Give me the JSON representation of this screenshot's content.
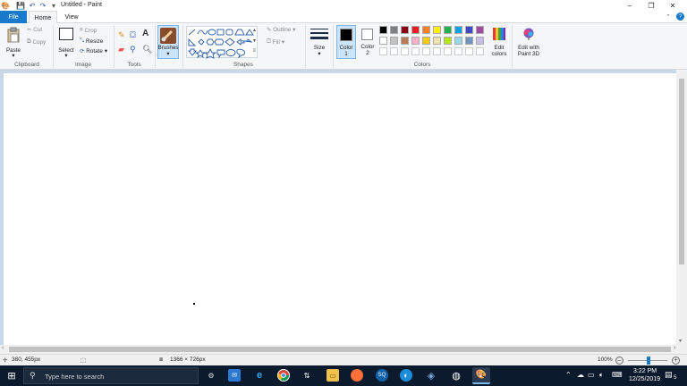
{
  "window": {
    "title": "Untitled - Paint",
    "controls": {
      "minimize": "–",
      "maximize": "❐",
      "close": "✕"
    }
  },
  "ribbon_tabs": [
    {
      "label": "File"
    },
    {
      "label": "Home"
    },
    {
      "label": "View"
    }
  ],
  "ribbon": {
    "clipboard": {
      "group_label": "Clipboard",
      "paste": "Paste",
      "cut": "Cut",
      "copy": "Copy"
    },
    "image": {
      "group_label": "Image",
      "select": "Select",
      "crop": "Crop",
      "resize": "Resize",
      "rotate": "Rotate"
    },
    "tools": {
      "group_label": "Tools"
    },
    "brushes": {
      "label": "Brushes"
    },
    "shapes": {
      "group_label": "Shapes",
      "outline": "Outline",
      "fill": "Fill"
    },
    "size": {
      "label": "Size"
    },
    "colors": {
      "group_label": "Colors",
      "color1_label": "Color",
      "color1_num": "1",
      "color2_label": "Color",
      "color2_num": "2",
      "color1": "#000000",
      "color2": "#ffffff",
      "edit_colors": "Edit colors",
      "paint3d": "Edit with Paint 3D",
      "palette_row1": [
        "#000000",
        "#7f7f7f",
        "#880015",
        "#ed1c24",
        "#ff7f27",
        "#fff200",
        "#22b14c",
        "#00a2e8",
        "#3f48cc",
        "#a349a4"
      ],
      "palette_row2": [
        "#ffffff",
        "#c3c3c3",
        "#b97a57",
        "#ffaec9",
        "#ffc90e",
        "#efe4b0",
        "#b5e61d",
        "#99d9ea",
        "#7092be",
        "#c8bfe7"
      ]
    }
  },
  "status": {
    "cursor": "380, 455px",
    "image_size": "1366 × 726px",
    "zoom": "100%"
  },
  "taskbar": {
    "search_placeholder": "Type here to search",
    "time": "3:22 PM",
    "date": "12/25/2019",
    "notification_count": "5"
  }
}
